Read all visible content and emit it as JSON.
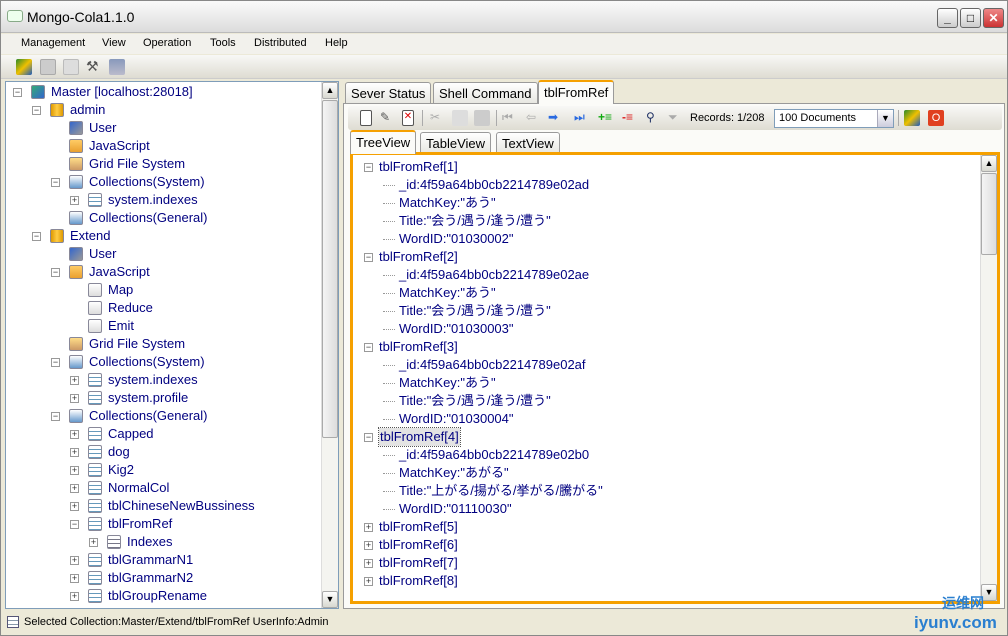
{
  "window": {
    "title": "Mongo-Cola1.1.0"
  },
  "menu": [
    "Management",
    "View",
    "Operation",
    "Tools",
    "Distributed",
    "Help"
  ],
  "toolbar_icons": [
    "connect-icon",
    "disconnect-icon",
    "key-icon",
    "tools-icon",
    "search-db-icon"
  ],
  "left_tree": [
    {
      "label": "Master [localhost:28018]",
      "level": 0,
      "icon": "server-icon",
      "exp": "-",
      "color": "#000"
    },
    {
      "label": "admin",
      "level": 1,
      "icon": "database-icon",
      "exp": "-"
    },
    {
      "label": "User",
      "level": 2,
      "icon": "user-icon"
    },
    {
      "label": "JavaScript",
      "level": 2,
      "icon": "javascript-folder-icon"
    },
    {
      "label": "Grid File System",
      "level": 2,
      "icon": "gridfs-icon"
    },
    {
      "label": "Collections(System)",
      "level": 2,
      "icon": "collections-icon",
      "exp": "-"
    },
    {
      "label": "system.indexes",
      "level": 3,
      "icon": "table-icon",
      "exp": "+"
    },
    {
      "label": "Collections(General)",
      "level": 2,
      "icon": "collections-icon"
    },
    {
      "label": "Extend",
      "level": 1,
      "icon": "database-icon",
      "exp": "-"
    },
    {
      "label": "User",
      "level": 2,
      "icon": "user-icon"
    },
    {
      "label": "JavaScript",
      "level": 2,
      "icon": "javascript-folder-icon",
      "exp": "-"
    },
    {
      "label": "Map",
      "level": 3,
      "icon": "script-icon"
    },
    {
      "label": "Reduce",
      "level": 3,
      "icon": "script-icon"
    },
    {
      "label": "Emit",
      "level": 3,
      "icon": "script-icon"
    },
    {
      "label": "Grid File System",
      "level": 2,
      "icon": "gridfs-icon"
    },
    {
      "label": "Collections(System)",
      "level": 2,
      "icon": "collections-icon",
      "exp": "-"
    },
    {
      "label": "system.indexes",
      "level": 3,
      "icon": "table-icon",
      "exp": "+"
    },
    {
      "label": "system.profile",
      "level": 3,
      "icon": "table-icon",
      "exp": "+"
    },
    {
      "label": "Collections(General)",
      "level": 2,
      "icon": "collections-icon",
      "exp": "-"
    },
    {
      "label": "Capped",
      "level": 3,
      "icon": "table-icon",
      "exp": "+"
    },
    {
      "label": "dog",
      "level": 3,
      "icon": "table-icon",
      "exp": "+"
    },
    {
      "label": "Kig2",
      "level": 3,
      "icon": "table-icon",
      "exp": "+"
    },
    {
      "label": "NormalCol",
      "level": 3,
      "icon": "table-icon",
      "exp": "+"
    },
    {
      "label": "tblChineseNewBussiness",
      "level": 3,
      "icon": "table-icon",
      "exp": "+"
    },
    {
      "label": "tblFromRef",
      "level": 3,
      "icon": "table-icon",
      "exp": "-"
    },
    {
      "label": "Indexes",
      "level": 4,
      "icon": "index-icon",
      "exp": "+"
    },
    {
      "label": "tblGrammarN1",
      "level": 3,
      "icon": "table-icon",
      "exp": "+"
    },
    {
      "label": "tblGrammarN2",
      "level": 3,
      "icon": "table-icon",
      "exp": "+"
    },
    {
      "label": "tblGroupRename",
      "level": 3,
      "icon": "table-icon",
      "exp": "+"
    }
  ],
  "tabs": [
    "Sever Status",
    "Shell Command",
    "tblFromRef"
  ],
  "active_tab": 2,
  "doc_toolbar": {
    "records_label": "Records:",
    "records_value": "1/208",
    "page_size": "100  Documents"
  },
  "view_tabs": [
    "TreeView",
    "TableView",
    "TextView"
  ],
  "active_view": 0,
  "doc_tree": [
    {
      "label": "tblFromRef[1]",
      "exp": "-",
      "fields": [
        "_id:4f59a64bb0cb2214789e02ad",
        "MatchKey:\"あう\"",
        "Title:\"会う/遇う/逢う/遭う\"",
        "WordID:\"01030002\""
      ]
    },
    {
      "label": "tblFromRef[2]",
      "exp": "-",
      "fields": [
        "_id:4f59a64bb0cb2214789e02ae",
        "MatchKey:\"あう\"",
        "Title:\"会う/遇う/逢う/遭う\"",
        "WordID:\"01030003\""
      ]
    },
    {
      "label": "tblFromRef[3]",
      "exp": "-",
      "fields": [
        "_id:4f59a64bb0cb2214789e02af",
        "MatchKey:\"あう\"",
        "Title:\"会う/遇う/逢う/遭う\"",
        "WordID:\"01030004\""
      ]
    },
    {
      "label": "tblFromRef[4]",
      "exp": "-",
      "selected": true,
      "fields": [
        "_id:4f59a64bb0cb2214789e02b0",
        "MatchKey:\"あがる\"",
        "Title:\"上がる/揚がる/挙がる/騰がる\"",
        "WordID:\"01110030\""
      ]
    },
    {
      "label": "tblFromRef[5]",
      "exp": "+",
      "fields": []
    },
    {
      "label": "tblFromRef[6]",
      "exp": "+",
      "fields": []
    },
    {
      "label": "tblFromRef[7]",
      "exp": "+",
      "fields": []
    },
    {
      "label": "tblFromRef[8]",
      "exp": "+",
      "fields": []
    }
  ],
  "status": {
    "text": "Selected Collection:Master/Extend/tblFromRef  UserInfo:Admin"
  },
  "watermark": {
    "top": "运维网",
    "bottom": "iyunv.com"
  },
  "colors": {
    "accent": "#f5a000",
    "tree_text": "#000080"
  }
}
